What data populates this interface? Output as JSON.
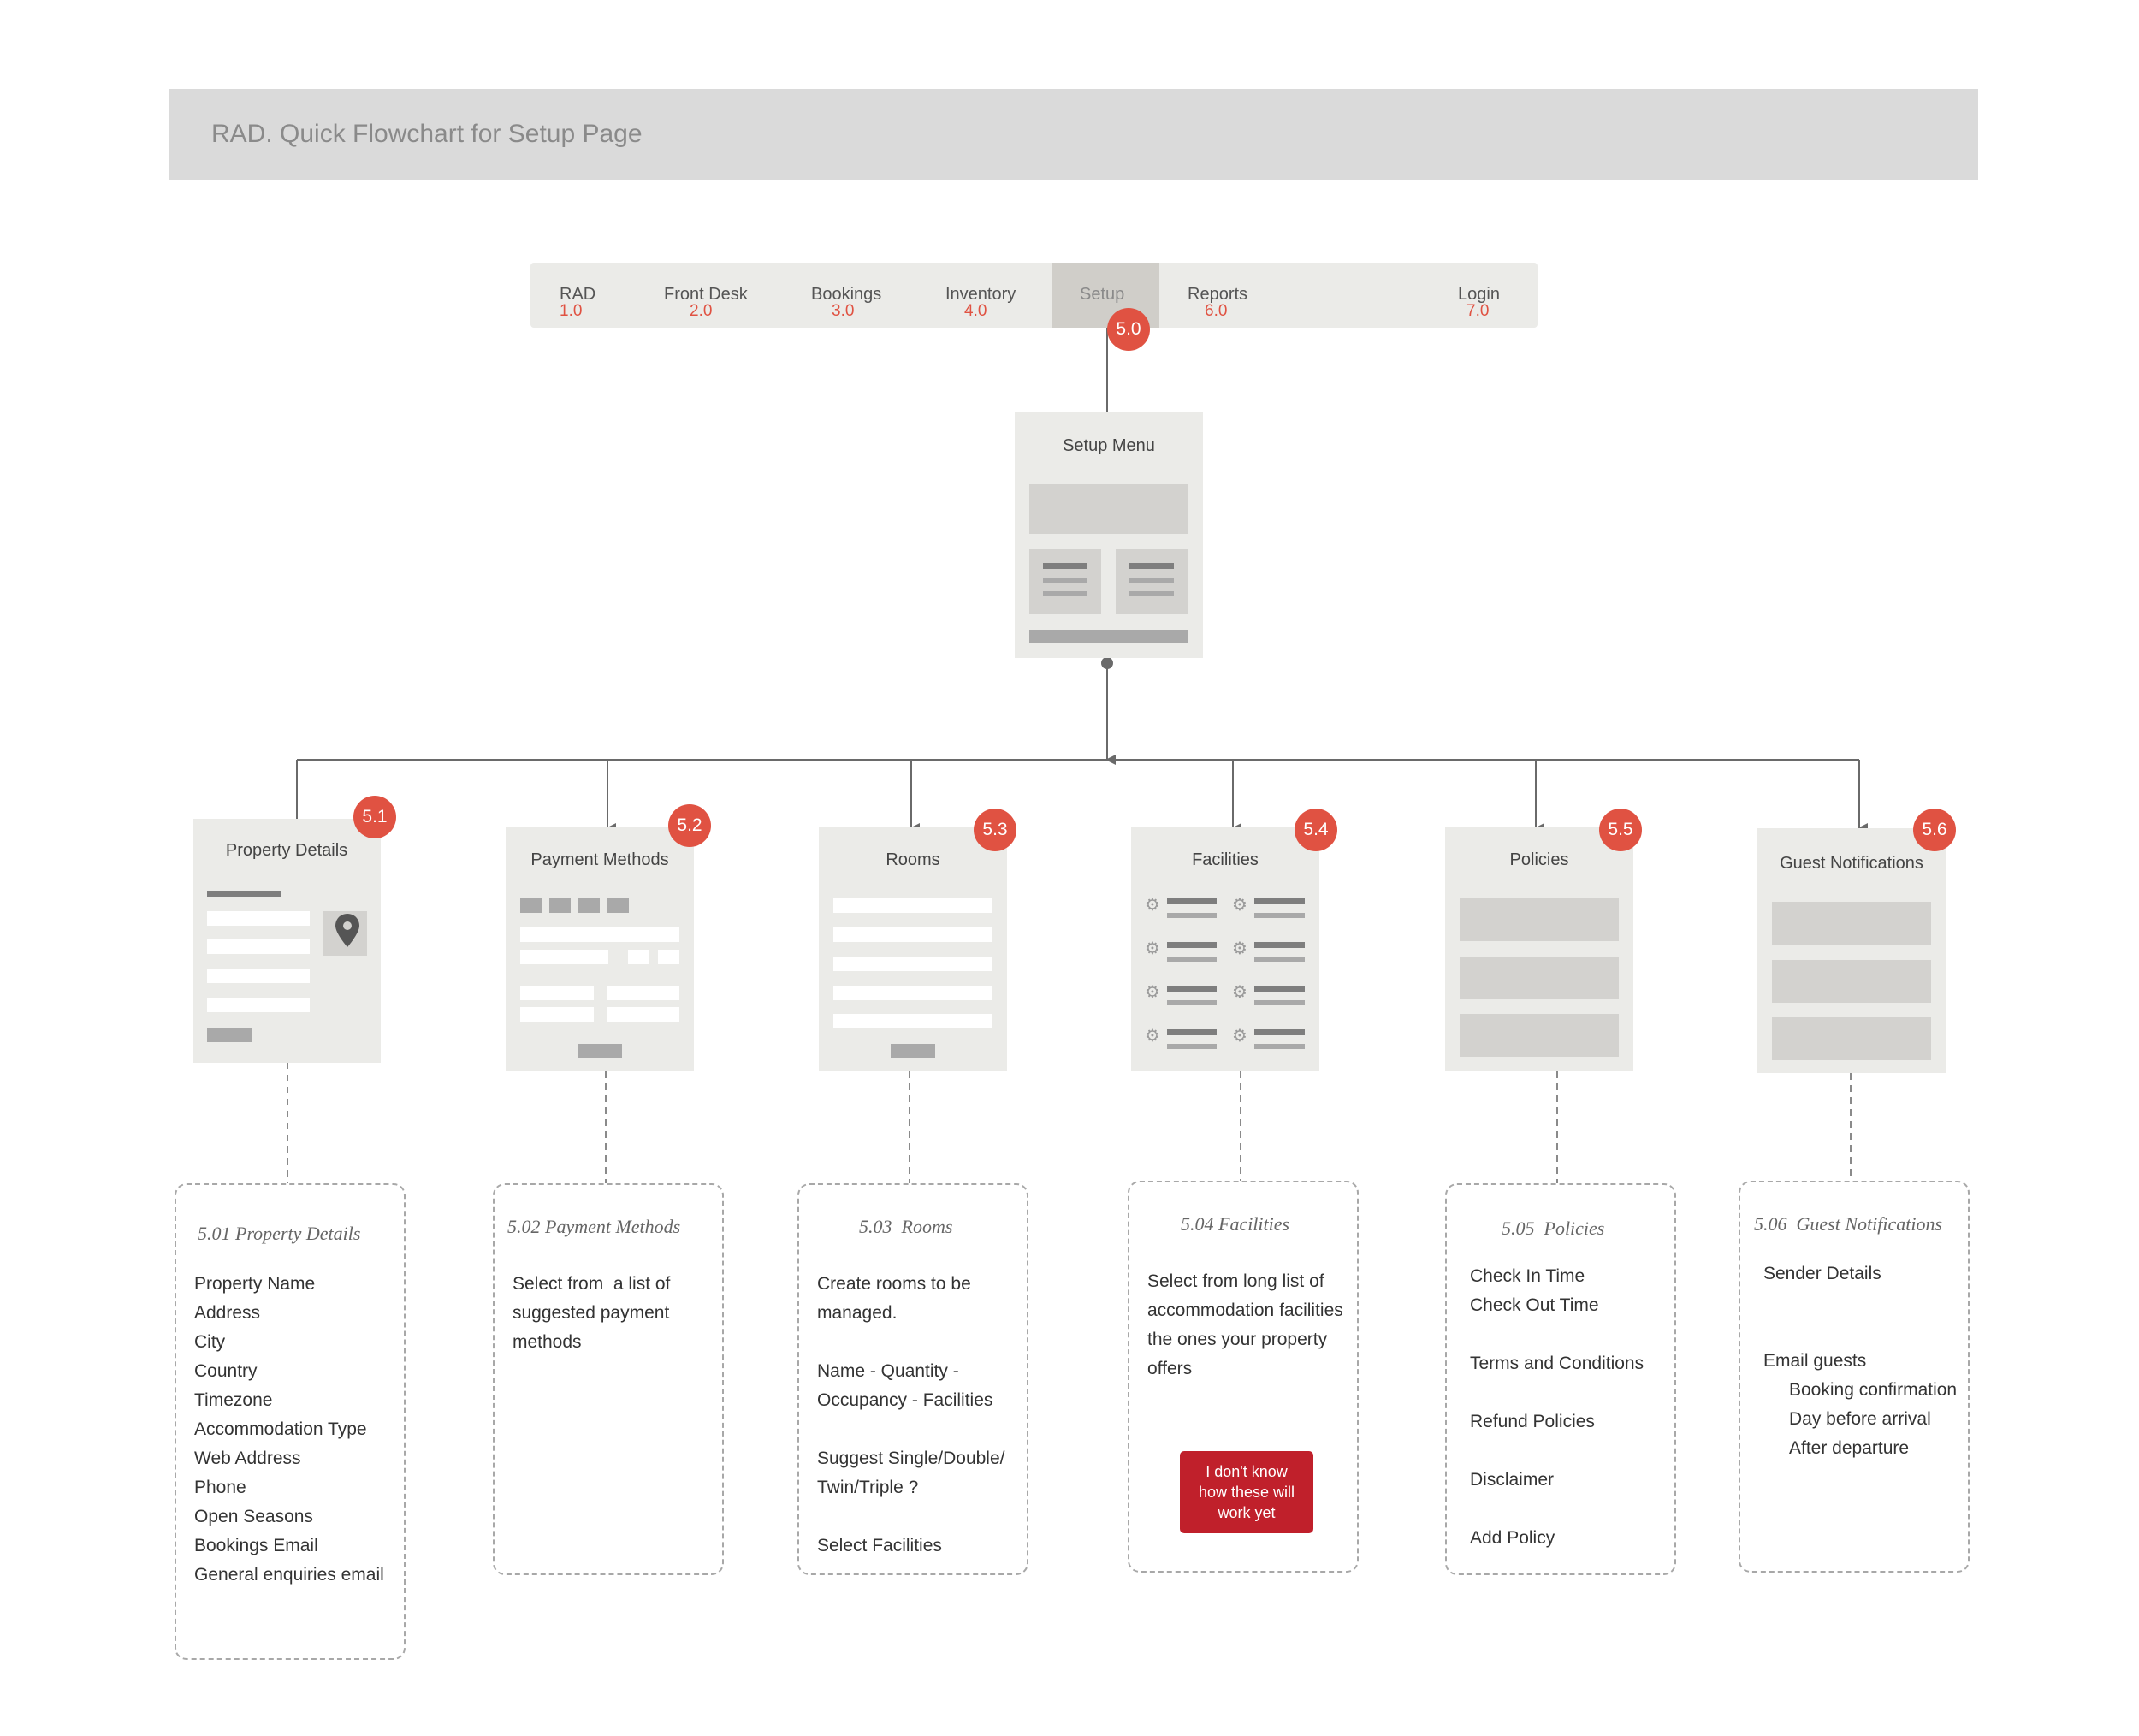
{
  "header": {
    "title": "RAD. Quick Flowchart for Setup Page"
  },
  "nav": [
    {
      "label": "RAD",
      "num": "1.0"
    },
    {
      "label": "Front Desk",
      "num": "2.0"
    },
    {
      "label": "Bookings",
      "num": "3.0"
    },
    {
      "label": "Inventory",
      "num": "4.0"
    },
    {
      "label": "Setup",
      "num": ""
    },
    {
      "label": "Reports",
      "num": "6.0"
    },
    {
      "label": "Login",
      "num": "7.0"
    }
  ],
  "setup_badge": "5.0",
  "setup_menu": {
    "title": "Setup Menu"
  },
  "cards": [
    {
      "badge": "5.1",
      "title": "Property Details"
    },
    {
      "badge": "5.2",
      "title": "Payment Methods"
    },
    {
      "badge": "5.3",
      "title": "Rooms"
    },
    {
      "badge": "5.4",
      "title": "Facilities"
    },
    {
      "badge": "5.5",
      "title": "Policies"
    },
    {
      "badge": "5.6",
      "title": "Guest Notifications"
    }
  ],
  "details": [
    {
      "title": "5.01 Property Details",
      "lines": [
        "Property Name",
        "Address",
        "City",
        "Country",
        "Timezone",
        "Accommodation Type",
        "Web Address",
        "Phone",
        "Open Seasons",
        "Bookings Email",
        "General enquiries email"
      ]
    },
    {
      "title": "5.02 Payment Methods",
      "lines": [
        "Select from  a list of",
        " suggested payment",
        " methods"
      ]
    },
    {
      "title": "5.03  Rooms",
      "lines": [
        "Create rooms to be",
        "managed.",
        "",
        "Name - Quantity -",
        "Occupancy - Facilities",
        "",
        "Suggest Single/Double/",
        "Twin/Triple ?",
        "",
        "Select Facilities"
      ]
    },
    {
      "title": "5.04 Facilities",
      "lines": [
        "Select from long list of",
        "accommodation facilities",
        " the ones your property",
        "offers"
      ],
      "button": [
        "I don't know",
        "how these will",
        "work yet"
      ]
    },
    {
      "title": "5.05  Policies",
      "lines": [
        "Check In Time",
        "Check Out Time",
        "",
        "Terms and Conditions",
        "",
        "Refund Policies",
        "",
        "Disclaimer",
        "",
        "Add Policy"
      ]
    },
    {
      "title": "5.06  Guest Notifications",
      "lines": [
        "Sender Details",
        "",
        "",
        "Email guests",
        "     Booking confirmation",
        "     Day before arrival",
        "     After departure"
      ]
    }
  ]
}
